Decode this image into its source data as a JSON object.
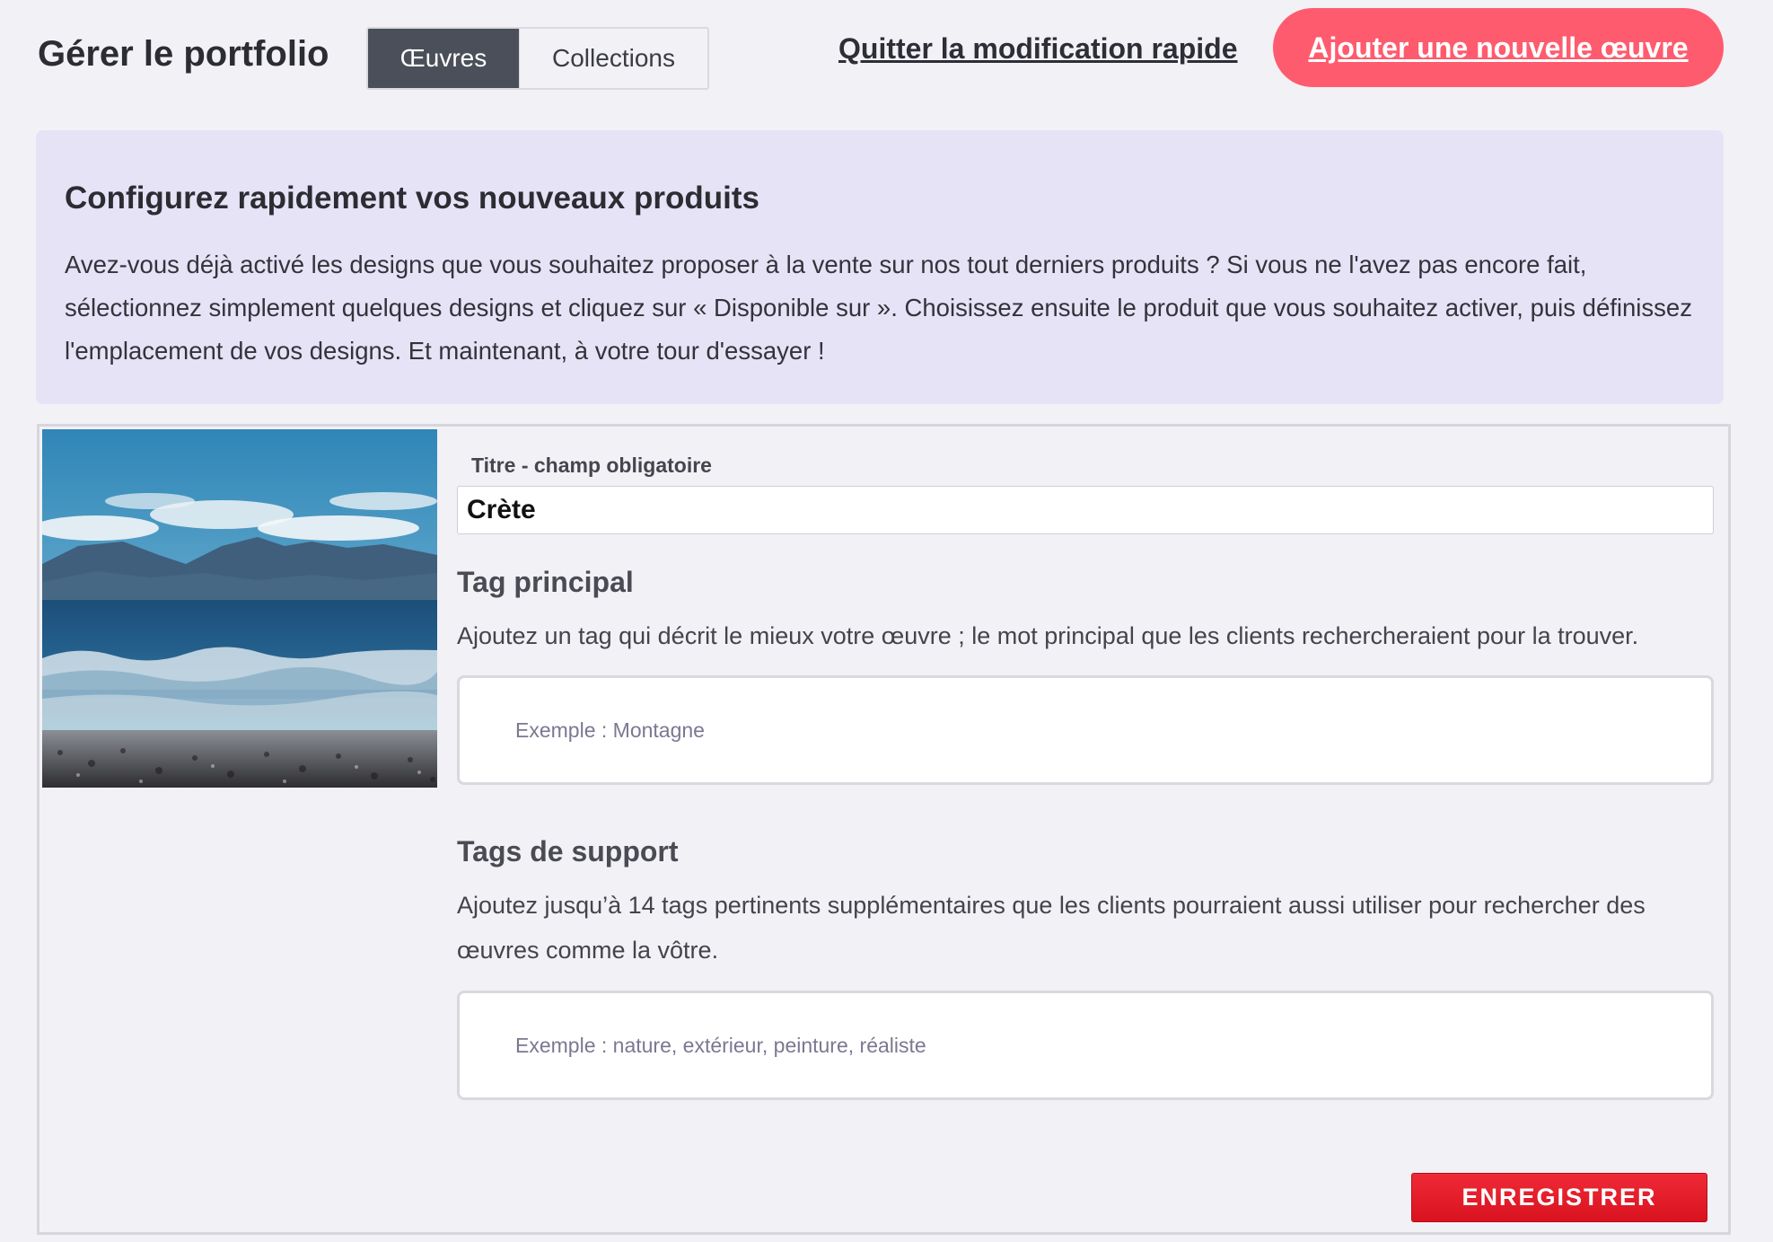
{
  "header": {
    "title": "Gérer le portfolio",
    "tabs": [
      {
        "label": "Œuvres",
        "active": true
      },
      {
        "label": "Collections",
        "active": false
      }
    ],
    "quit_link": "Quitter la modification rapide",
    "add_button": "Ajouter une nouvelle œuvre"
  },
  "banner": {
    "title": "Configurez rapidement vos nouveaux produits",
    "text": "Avez-vous déjà activé les designs que vous souhaitez proposer à la vente sur nos tout derniers produits ? Si vous ne l'avez pas encore fait, sélectionnez simplement quelques designs et cliquez sur « Disponible sur ». Choisissez ensuite le produit que vous souhaitez activer, puis définissez l'emplacement de vos designs. Et maintenant, à votre tour d'essayer !"
  },
  "editor": {
    "title_label": "Titre - champ obligatoire",
    "title_value": "Crète",
    "main_tag": {
      "heading": "Tag principal",
      "description": "Ajoutez un tag qui décrit le mieux votre œuvre ; le mot principal que les clients rechercheraient pour la trouver.",
      "placeholder": "Exemple : Montagne"
    },
    "support_tags": {
      "heading": "Tags de support",
      "description": "Ajoutez jusqu’à 14 tags pertinents supplémentaires que les clients pourraient aussi utiliser pour rechercher des œuvres comme la vôtre.",
      "placeholder": "Exemple : nature, extérieur, peinture, réaliste"
    },
    "save_button": "ENREGISTRER"
  },
  "colors": {
    "page_bg": "#f2f1f6",
    "banner_bg": "#e6e3f6",
    "accent_pink": "#ff5b6e",
    "save_red": "#e01b28",
    "tab_active": "#4b4f59"
  }
}
